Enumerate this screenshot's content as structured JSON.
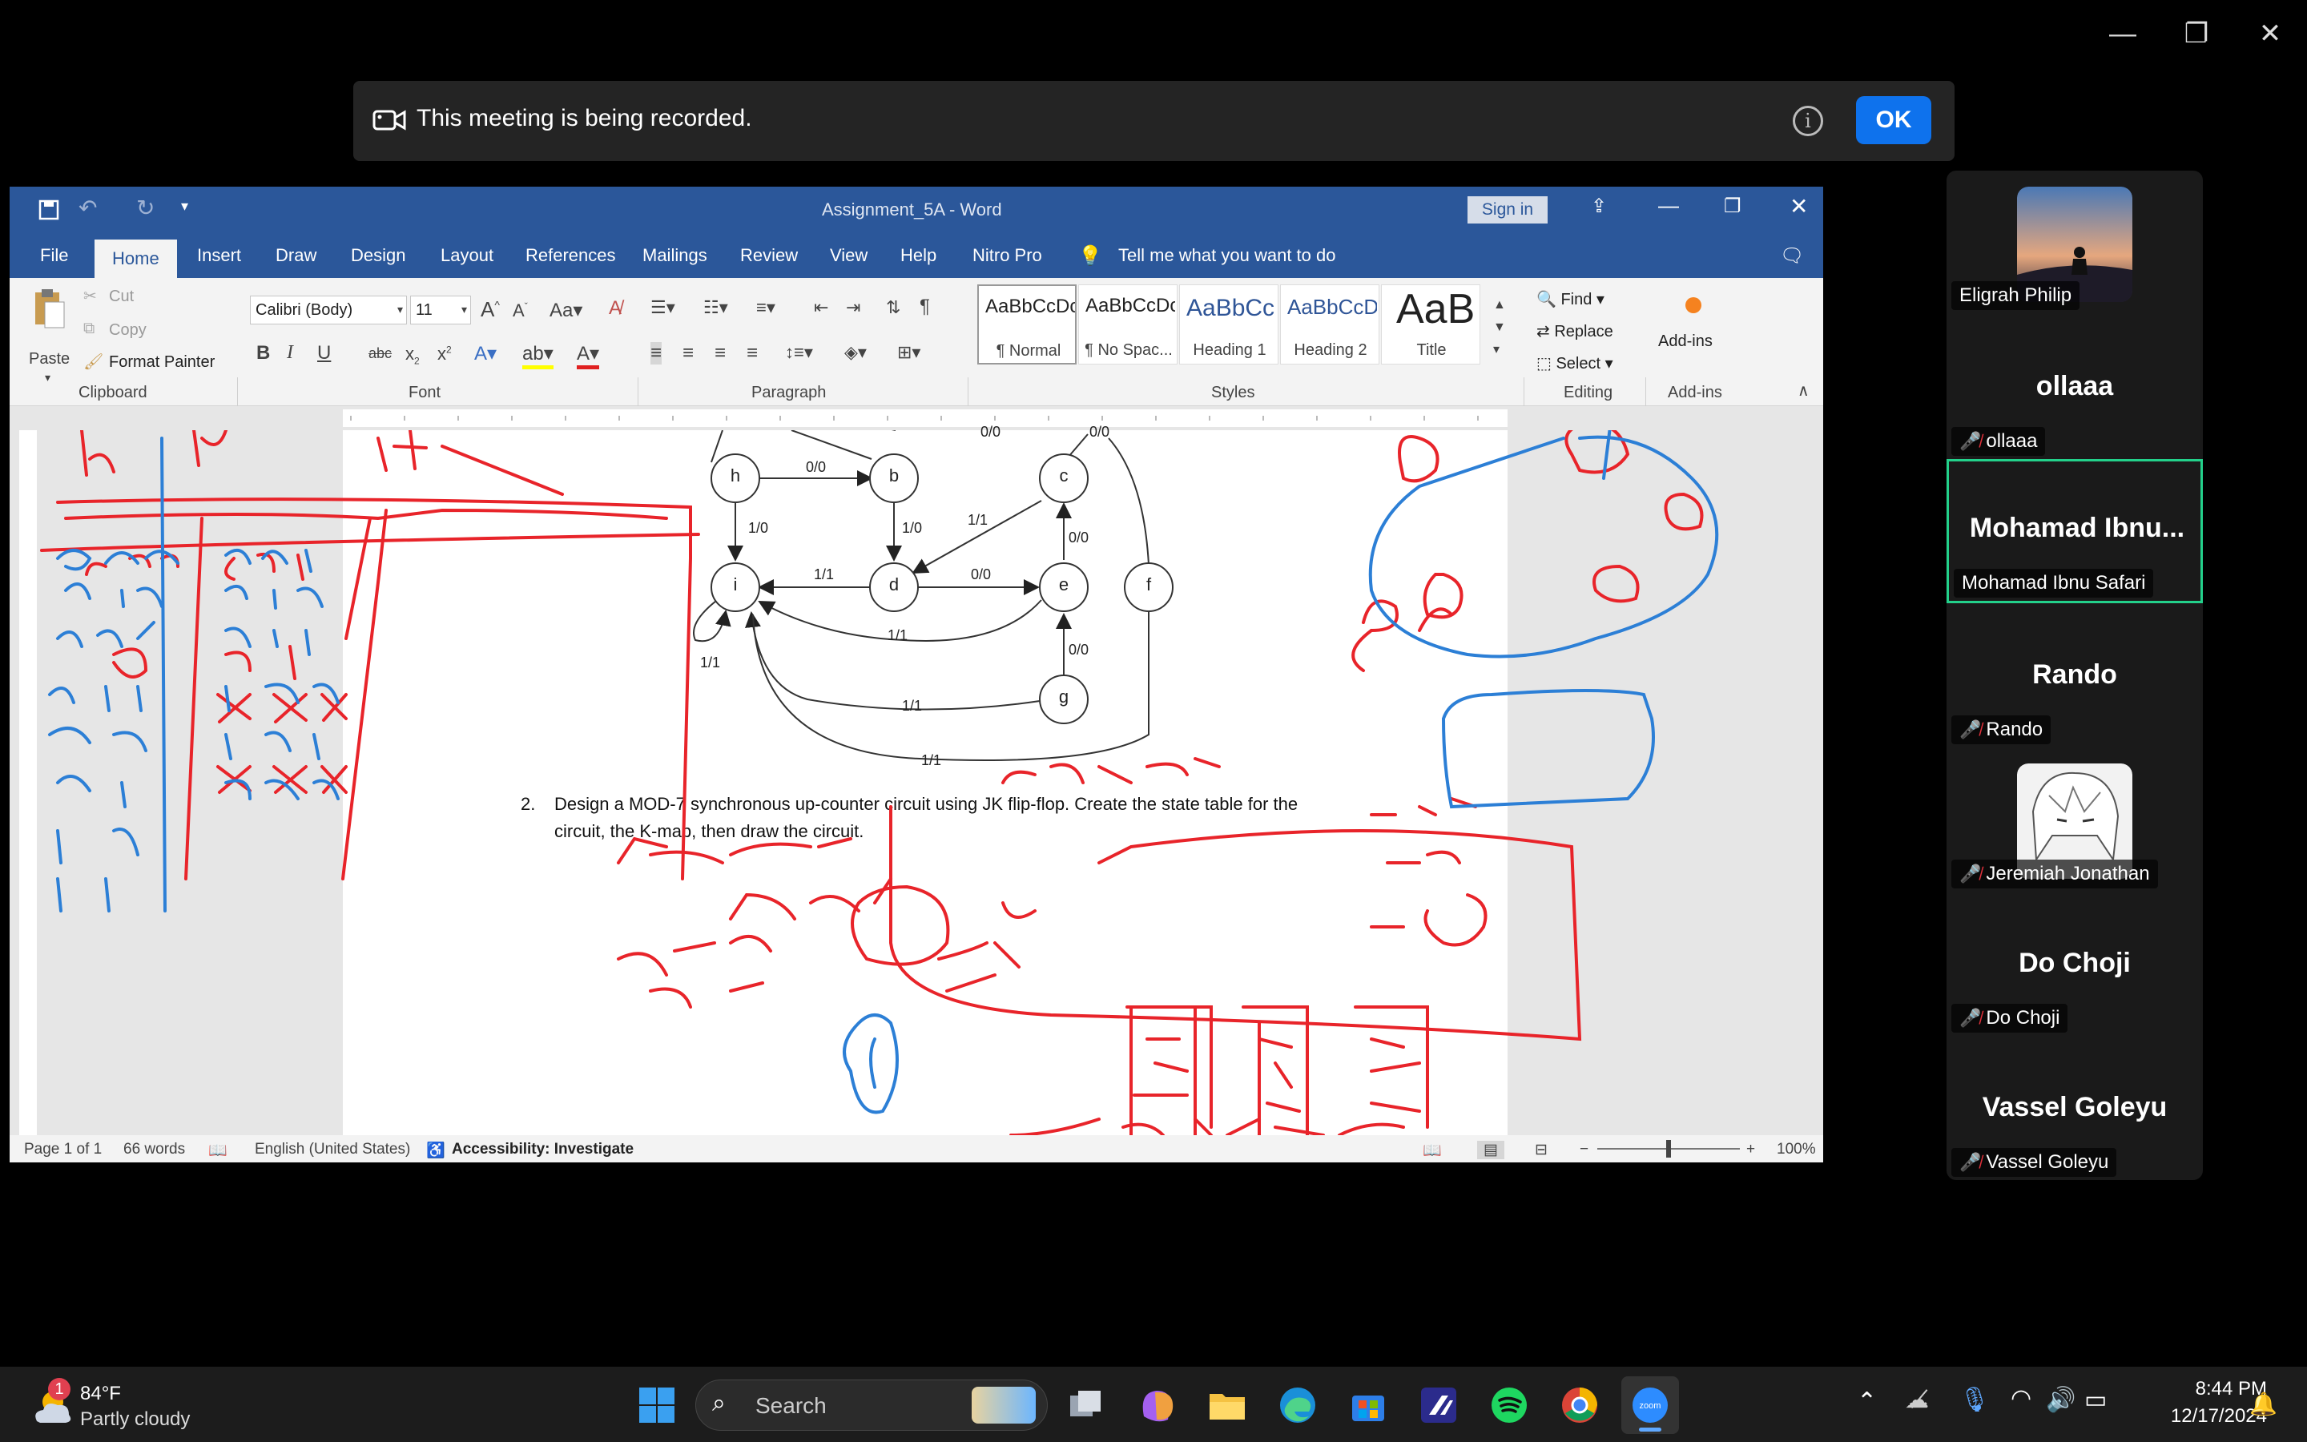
{
  "window_controls": {
    "minimize": "—",
    "restore": "❐",
    "close": "✕"
  },
  "banner": {
    "text": "This meeting is being recorded.",
    "ok": "OK",
    "info": "i"
  },
  "word": {
    "title": "Assignment_5A  -  Word",
    "sign_in": "Sign in",
    "tabs": [
      "File",
      "Home",
      "Insert",
      "Draw",
      "Design",
      "Layout",
      "References",
      "Mailings",
      "Review",
      "View",
      "Help",
      "Nitro Pro"
    ],
    "tell_me": "Tell me what you want to do",
    "clipboard": {
      "paste": "Paste",
      "cut": "Cut",
      "copy": "Copy",
      "format_painter": "Format Painter",
      "label": "Clipboard"
    },
    "font": {
      "name": "Calibri (Body)",
      "size": "11",
      "label": "Font"
    },
    "paragraph": {
      "label": "Paragraph"
    },
    "styles": {
      "label": "Styles",
      "items": [
        {
          "preview": "AaBbCcDc",
          "name": "¶ Normal"
        },
        {
          "preview": "AaBbCcDc",
          "name": "¶ No Spac..."
        },
        {
          "preview": "AaBbCc",
          "name": "Heading 1"
        },
        {
          "preview": "AaBbCcD",
          "name": "Heading 2"
        },
        {
          "preview": "AaB",
          "name": "Title"
        }
      ]
    },
    "editing": {
      "find": "Find",
      "replace": "Replace",
      "select": "Select",
      "label": "Editing"
    },
    "addins": {
      "name": "Add-ins",
      "label": "Add-ins"
    },
    "document": {
      "question_number": "2.",
      "question_line1": "Design a MOD-7 synchronous up-counter circuit using JK flip-flop. Create the state table for the",
      "question_line2": "circuit, the K-map, then draw the circuit.",
      "diagram": {
        "nodes": [
          "h",
          "b",
          "c",
          "i",
          "d",
          "e",
          "f",
          "g"
        ],
        "edge_labels": [
          "0/0",
          "0/0",
          "0/0",
          "1/0",
          "1/0",
          "1/1",
          "0/0",
          "0/0",
          "1/1",
          "1/1",
          "0/0",
          "1/1",
          "1/1",
          "1/1"
        ]
      }
    },
    "status": {
      "page": "Page 1 of 1",
      "words": "66 words",
      "language": "English (United States)",
      "accessibility": "Accessibility: Investigate",
      "zoom": "100%"
    }
  },
  "participants": [
    {
      "name": "Eligrah Philip",
      "muted": false,
      "has_photo": true
    },
    {
      "big": "ollaaa",
      "name": "ollaaa",
      "muted": true
    },
    {
      "big": "Mohamad  Ibnu...",
      "name": "Mohamad Ibnu Safari",
      "muted": false,
      "active": true
    },
    {
      "big": "Rando",
      "name": "Rando",
      "muted": true
    },
    {
      "name": "Jeremiah Jonathan",
      "muted": true,
      "has_photo": true
    },
    {
      "big": "Do Choji",
      "name": "Do Choji",
      "muted": true
    },
    {
      "big": "Vassel Goleyu",
      "name": "Vassel Goleyu",
      "muted": true
    }
  ],
  "taskbar": {
    "weather_temp": "84°F",
    "weather_desc": "Partly cloudy",
    "weather_badge": "1",
    "search": "Search",
    "time": "8:44 PM",
    "date": "12/17/2024",
    "apps": [
      "start-icon",
      "search-icon",
      "task-view-icon",
      "copilot-icon",
      "file-explorer-icon",
      "edge-icon",
      "store-icon",
      "vscode-icon",
      "spotify-icon",
      "chrome-icon",
      "zoom-icon"
    ]
  }
}
